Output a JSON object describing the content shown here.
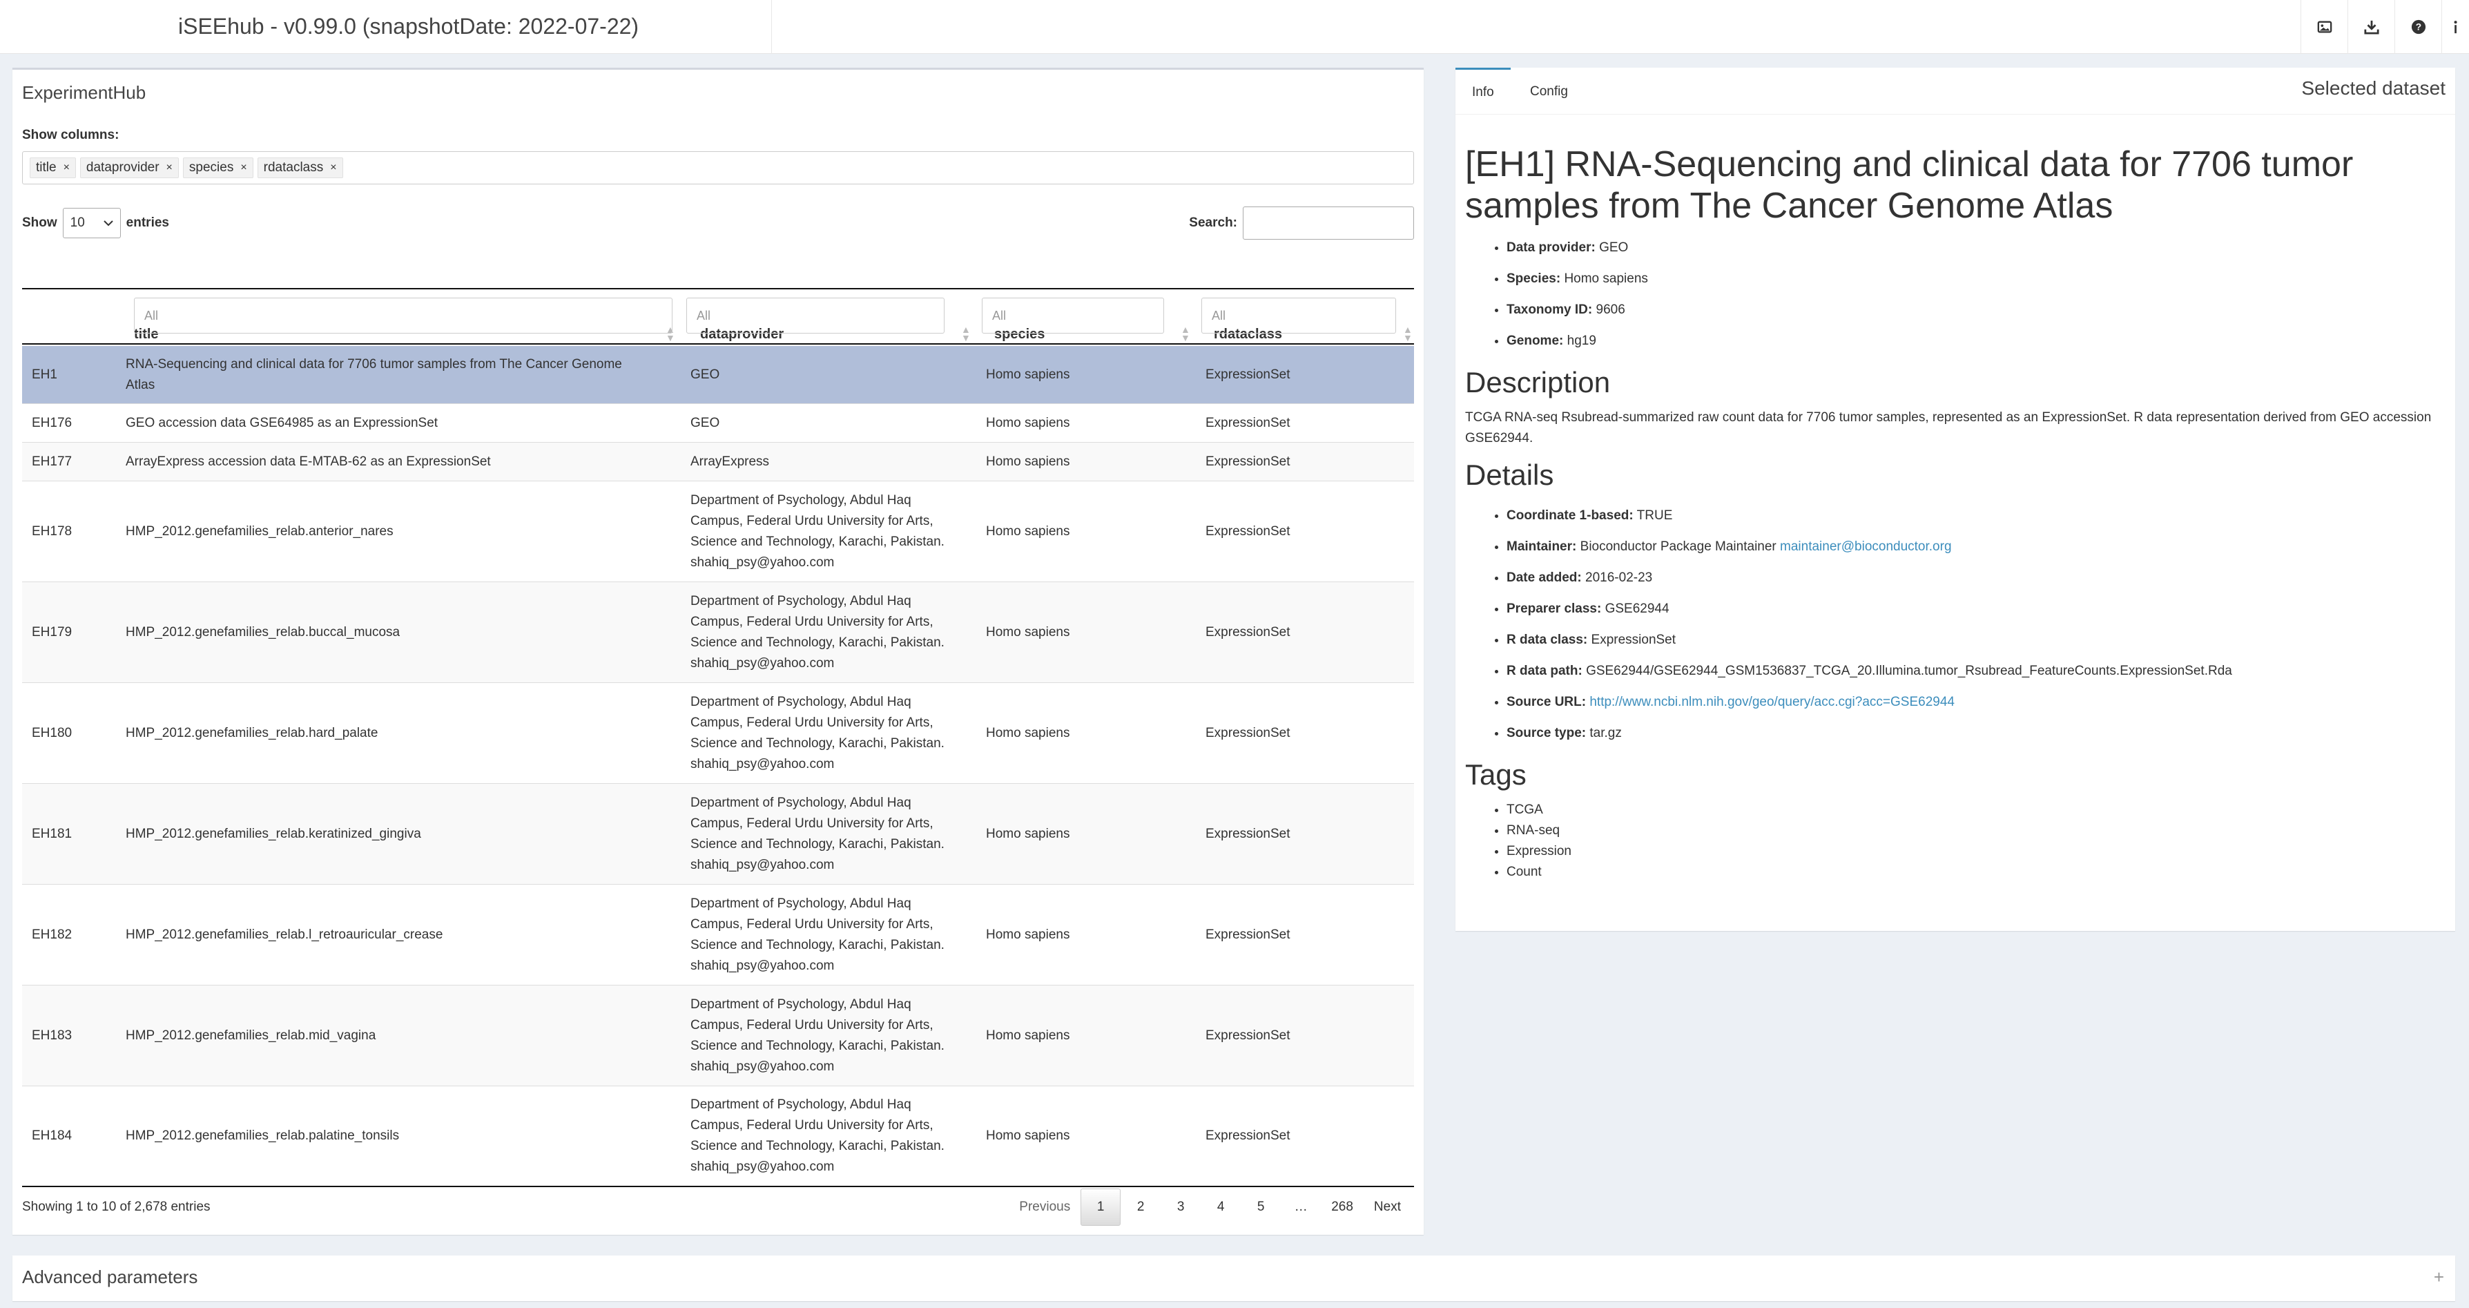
{
  "header": {
    "title": "iSEEhub - v0.99.0 (snapshotDate: 2022-07-22)",
    "icons": [
      "screenshot-icon",
      "download-icon",
      "help-icon",
      "info-icon"
    ]
  },
  "left": {
    "title": "ExperimentHub",
    "show_columns_label": "Show columns:",
    "chips": [
      {
        "label": "title",
        "x": "×"
      },
      {
        "label": "dataprovider",
        "x": "×"
      },
      {
        "label": "species",
        "x": "×"
      },
      {
        "label": "rdataclass",
        "x": "×"
      }
    ],
    "show_label": "Show",
    "entries_value": "10",
    "entries_label": "entries",
    "search_label": "Search:",
    "columns": [
      "title",
      "dataprovider",
      "species",
      "rdataclass"
    ],
    "filter_placeholder": "All",
    "rows": [
      {
        "id": "EH1",
        "title": "RNA-Sequencing and clinical data for 7706 tumor samples from The Cancer Genome Atlas",
        "dataprovider": "GEO",
        "species": "Homo sapiens",
        "rdataclass": "ExpressionSet"
      },
      {
        "id": "EH176",
        "title": "GEO accession data GSE64985 as an ExpressionSet",
        "dataprovider": "GEO",
        "species": "Homo sapiens",
        "rdataclass": "ExpressionSet"
      },
      {
        "id": "EH177",
        "title": "ArrayExpress accession data E-MTAB-62 as an ExpressionSet",
        "dataprovider": "ArrayExpress",
        "species": "Homo sapiens",
        "rdataclass": "ExpressionSet"
      },
      {
        "id": "EH178",
        "title": "HMP_2012.genefamilies_relab.anterior_nares",
        "dataprovider": "Department of Psychology, Abdul Haq Campus, Federal Urdu University for Arts, Science and Technology, Karachi, Pakistan. shahiq_psy@yahoo.com",
        "species": "Homo sapiens",
        "rdataclass": "ExpressionSet"
      },
      {
        "id": "EH179",
        "title": "HMP_2012.genefamilies_relab.buccal_mucosa",
        "dataprovider": "Department of Psychology, Abdul Haq Campus, Federal Urdu University for Arts, Science and Technology, Karachi, Pakistan. shahiq_psy@yahoo.com",
        "species": "Homo sapiens",
        "rdataclass": "ExpressionSet"
      },
      {
        "id": "EH180",
        "title": "HMP_2012.genefamilies_relab.hard_palate",
        "dataprovider": "Department of Psychology, Abdul Haq Campus, Federal Urdu University for Arts, Science and Technology, Karachi, Pakistan. shahiq_psy@yahoo.com",
        "species": "Homo sapiens",
        "rdataclass": "ExpressionSet"
      },
      {
        "id": "EH181",
        "title": "HMP_2012.genefamilies_relab.keratinized_gingiva",
        "dataprovider": "Department of Psychology, Abdul Haq Campus, Federal Urdu University for Arts, Science and Technology, Karachi, Pakistan. shahiq_psy@yahoo.com",
        "species": "Homo sapiens",
        "rdataclass": "ExpressionSet"
      },
      {
        "id": "EH182",
        "title": "HMP_2012.genefamilies_relab.l_retroauricular_crease",
        "dataprovider": "Department of Psychology, Abdul Haq Campus, Federal Urdu University for Arts, Science and Technology, Karachi, Pakistan. shahiq_psy@yahoo.com",
        "species": "Homo sapiens",
        "rdataclass": "ExpressionSet"
      },
      {
        "id": "EH183",
        "title": "HMP_2012.genefamilies_relab.mid_vagina",
        "dataprovider": "Department of Psychology, Abdul Haq Campus, Federal Urdu University for Arts, Science and Technology, Karachi, Pakistan. shahiq_psy@yahoo.com",
        "species": "Homo sapiens",
        "rdataclass": "ExpressionSet"
      },
      {
        "id": "EH184",
        "title": "HMP_2012.genefamilies_relab.palatine_tonsils",
        "dataprovider": "Department of Psychology, Abdul Haq Campus, Federal Urdu University for Arts, Science and Technology, Karachi, Pakistan. shahiq_psy@yahoo.com",
        "species": "Homo sapiens",
        "rdataclass": "ExpressionSet"
      }
    ],
    "info": "Showing 1 to 10 of 2,678 entries",
    "pager": {
      "previous": "Previous",
      "pages": [
        "1",
        "2",
        "3",
        "4",
        "5",
        "…",
        "268"
      ],
      "next": "Next"
    }
  },
  "right": {
    "tabs": [
      "Info",
      "Config"
    ],
    "panel_title": "Selected dataset",
    "heading": "[EH1] RNA-Sequencing and clinical data for 7706 tumor samples from The Cancer Genome Atlas",
    "meta": [
      {
        "k": "Data provider:",
        "v": "GEO"
      },
      {
        "k": "Species:",
        "v": "Homo sapiens"
      },
      {
        "k": "Taxonomy ID:",
        "v": "9606"
      },
      {
        "k": "Genome:",
        "v": "hg19"
      }
    ],
    "description_heading": "Description",
    "description": "TCGA RNA-seq Rsubread-summarized raw count data for 7706 tumor samples, represented as an ExpressionSet. R data representation derived from GEO accession GSE62944.",
    "details_heading": "Details",
    "details": {
      "coord_k": "Coordinate 1-based:",
      "coord_v": "TRUE",
      "maint_k": "Maintainer:",
      "maint_v": "Bioconductor Package Maintainer",
      "maint_link": "maintainer@bioconductor.org",
      "date_k": "Date added:",
      "date_v": "2016-02-23",
      "prep_k": "Preparer class:",
      "prep_v": "GSE62944",
      "rclass_k": "R data class:",
      "rclass_v": "ExpressionSet",
      "rpath_k": "R data path:",
      "rpath_v": "GSE62944/GSE62944_GSM1536837_TCGA_20.Illumina.tumor_Rsubread_FeatureCounts.ExpressionSet.Rda",
      "srcurl_k": "Source URL:",
      "srcurl_v": "http://www.ncbi.nlm.nih.gov/geo/query/acc.cgi?acc=GSE62944",
      "srctype_k": "Source type:",
      "srctype_v": "tar.gz"
    },
    "tags_heading": "Tags",
    "tags": [
      "TCGA",
      "RNA-seq",
      "Expression",
      "Count"
    ]
  },
  "advanced": {
    "title": "Advanced parameters",
    "toggle": "+"
  }
}
